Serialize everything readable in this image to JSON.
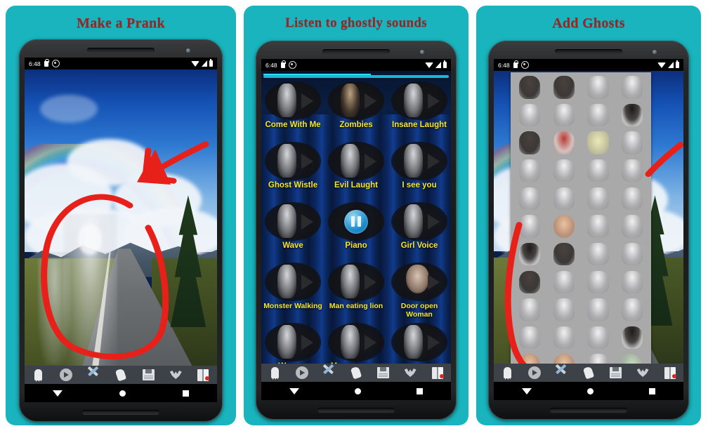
{
  "theme": {
    "panel_bg": "#19b4bd",
    "title_color": "#9c2424",
    "label_yellow": "#f6e62a",
    "seekbar_color": "#18b9d6",
    "gallery_bg": "#a9a9a9",
    "annotation_color": "#e8201a"
  },
  "panels": [
    {
      "title": "Make a Prank"
    },
    {
      "title": "Listen to ghostly sounds"
    },
    {
      "title": "Add Ghosts"
    }
  ],
  "status_bar": {
    "time": "6:48",
    "left_icons": [
      "lock-icon",
      "sync-icon"
    ],
    "right_icons": [
      "wifi-icon",
      "signal-icon",
      "battery-icon"
    ]
  },
  "sounds": [
    {
      "label": "Come With Me",
      "icon": "ghost-thumb",
      "state": "play"
    },
    {
      "label": "Zombies",
      "icon": "zombie-thumb",
      "state": "play"
    },
    {
      "label": "Insane Laught",
      "icon": "ghost-thumb",
      "state": "play"
    },
    {
      "label": "Ghost Wistle",
      "icon": "ghost-thumb",
      "state": "play"
    },
    {
      "label": "Evil Laught",
      "icon": "ghost-thumb",
      "state": "play"
    },
    {
      "label": "I see you",
      "icon": "ghost-thumb",
      "state": "play"
    },
    {
      "label": "Wave",
      "icon": "ghost-thumb",
      "state": "play"
    },
    {
      "label": "Piano",
      "icon": "pause-icon",
      "state": "playing"
    },
    {
      "label": "Girl Voice",
      "icon": "ghost-thumb",
      "state": "play"
    },
    {
      "label": "Monster Walking",
      "icon": "ghost-thumb",
      "state": "play"
    },
    {
      "label": "Man eating lion",
      "icon": "ghost-thumb",
      "state": "play"
    },
    {
      "label": "Door open Woman",
      "icon": "face-thumb",
      "state": "play"
    },
    {
      "label": "Woman screams",
      "icon": "ghost-thumb",
      "state": "play"
    },
    {
      "label": "Man screams",
      "icon": "ghost-thumb",
      "state": "play"
    },
    {
      "label": "Monster scream",
      "icon": "ghost-thumb",
      "state": "play"
    }
  ],
  "app_toolbar": {
    "items": [
      {
        "name": "ghost-eraser-icon"
      },
      {
        "name": "play-icon"
      },
      {
        "name": "tools-icon"
      },
      {
        "name": "ghost-hand-icon"
      },
      {
        "name": "save-icon"
      },
      {
        "name": "bat-icon"
      },
      {
        "name": "exit-icon"
      }
    ]
  },
  "nav_bar": {
    "items": [
      {
        "name": "back-button"
      },
      {
        "name": "home-button"
      },
      {
        "name": "recents-button"
      }
    ]
  },
  "gallery": {
    "columns": 4,
    "rows": 11,
    "styles": [
      "dk",
      "dk",
      "",
      "",
      "",
      "",
      "",
      "hair",
      "dk",
      "red",
      "yel",
      "",
      "",
      "",
      "",
      "",
      "",
      "",
      "",
      "",
      "",
      "skin",
      "",
      "",
      "hair",
      "dk",
      "",
      "",
      "dk",
      "",
      "",
      "",
      "",
      "",
      "",
      "",
      "",
      "",
      "",
      "hair",
      "skin",
      "skin",
      "",
      "grn"
    ]
  },
  "scene": {
    "description": "ghost-photo-preview",
    "elements": [
      "sky",
      "rainbow",
      "clouds",
      "mountains",
      "road",
      "trees",
      "ghost-figure",
      "ghost-child"
    ],
    "annotations": [
      "red-circle",
      "red-arrow"
    ]
  }
}
